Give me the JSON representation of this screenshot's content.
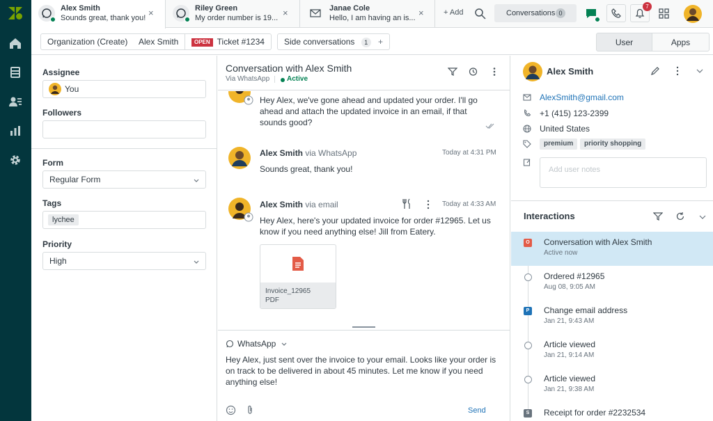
{
  "tabs": [
    {
      "name": "Alex Smith",
      "subtitle": "Sounds great, thank you!",
      "channel": "whatsapp",
      "active": true
    },
    {
      "name": "Riley Green",
      "subtitle": "My order number is 19...",
      "channel": "whatsapp",
      "active": false
    },
    {
      "name": "Janae Cole",
      "subtitle": "Hello, I am having an is...",
      "channel": "email",
      "active": false
    }
  ],
  "topbar": {
    "add_label": "+ Add",
    "conversations_label": "Conversations",
    "conversations_count": "0",
    "notification_count": "7"
  },
  "subtabs": {
    "organization": "Organization (Create)",
    "user": "Alex Smith",
    "open_badge": "OPEN",
    "ticket": "Ticket #1234",
    "side_conversations": "Side conversations",
    "side_count": "1",
    "plus": "+"
  },
  "context_toggle": {
    "user": "User",
    "apps": "Apps"
  },
  "ticket_fields": {
    "assignee_label": "Assignee",
    "assignee_value": "You",
    "followers_label": "Followers",
    "form_label": "Form",
    "form_value": "Regular Form",
    "tags_label": "Tags",
    "tag": "lychee",
    "priority_label": "Priority",
    "priority_value": "High"
  },
  "conversation": {
    "title": "Conversation with Alex Smith",
    "via": "Via WhatsApp",
    "status": "Active"
  },
  "messages": [
    {
      "text": "Hey Alex, we've gone ahead and updated your order. I'll go ahead and attach the updated invoice in an email, if that sounds good?"
    },
    {
      "sender": "Alex Smith",
      "via": "via WhatsApp",
      "time": "Today at 4:31 PM",
      "text": "Sounds great, thank you!"
    },
    {
      "sender": "Alex Smith",
      "via": "via email",
      "time": "Today at 4:33 AM",
      "text": "Hey Alex, here's your updated invoice for order #12965. Let us know if you need anything else! Jill from Eatery."
    }
  ],
  "attachment": {
    "name": "Invoice_12965",
    "type": "PDF"
  },
  "composer": {
    "channel": "WhatsApp",
    "text": "Hey Alex, just sent over the invoice to your email. Looks like your order is on track to be delivered in about 45 minutes. Let me know if you need anything else!",
    "send": "Send"
  },
  "user_panel": {
    "name": "Alex Smith",
    "email": "AlexSmith@gmail.com",
    "phone": "+1 (415) 123-2399",
    "country": "United States",
    "tags": [
      "premium",
      "priority shopping"
    ],
    "notes_placeholder": "Add user notes"
  },
  "interactions": {
    "title": "Interactions",
    "items": [
      {
        "title": "Conversation with Alex Smith",
        "sub": "Active now",
        "marker": "O",
        "marker_color": "#e35b47"
      },
      {
        "title": "Ordered #12965",
        "sub": "Aug 08, 9:05 AM",
        "marker": "circle"
      },
      {
        "title": "Change email address",
        "sub": "Jan 21, 9:43 AM",
        "marker": "P",
        "marker_color": "#1f73b7"
      },
      {
        "title": "Article viewed",
        "sub": "Jan 21, 9:14 AM",
        "marker": "circle"
      },
      {
        "title": "Article viewed",
        "sub": "Jan 21, 9:38 AM",
        "marker": "circle"
      },
      {
        "title": "Receipt for order #2232534",
        "sub": "",
        "marker": "S",
        "marker_color": "#68737d"
      }
    ]
  },
  "colors": {
    "nav": "#03363d",
    "accent": "#1f73b7",
    "active_green": "#038153",
    "selected_row": "#d1e8f5",
    "open_badge": "#cc3340",
    "notification": "#cc3340"
  }
}
